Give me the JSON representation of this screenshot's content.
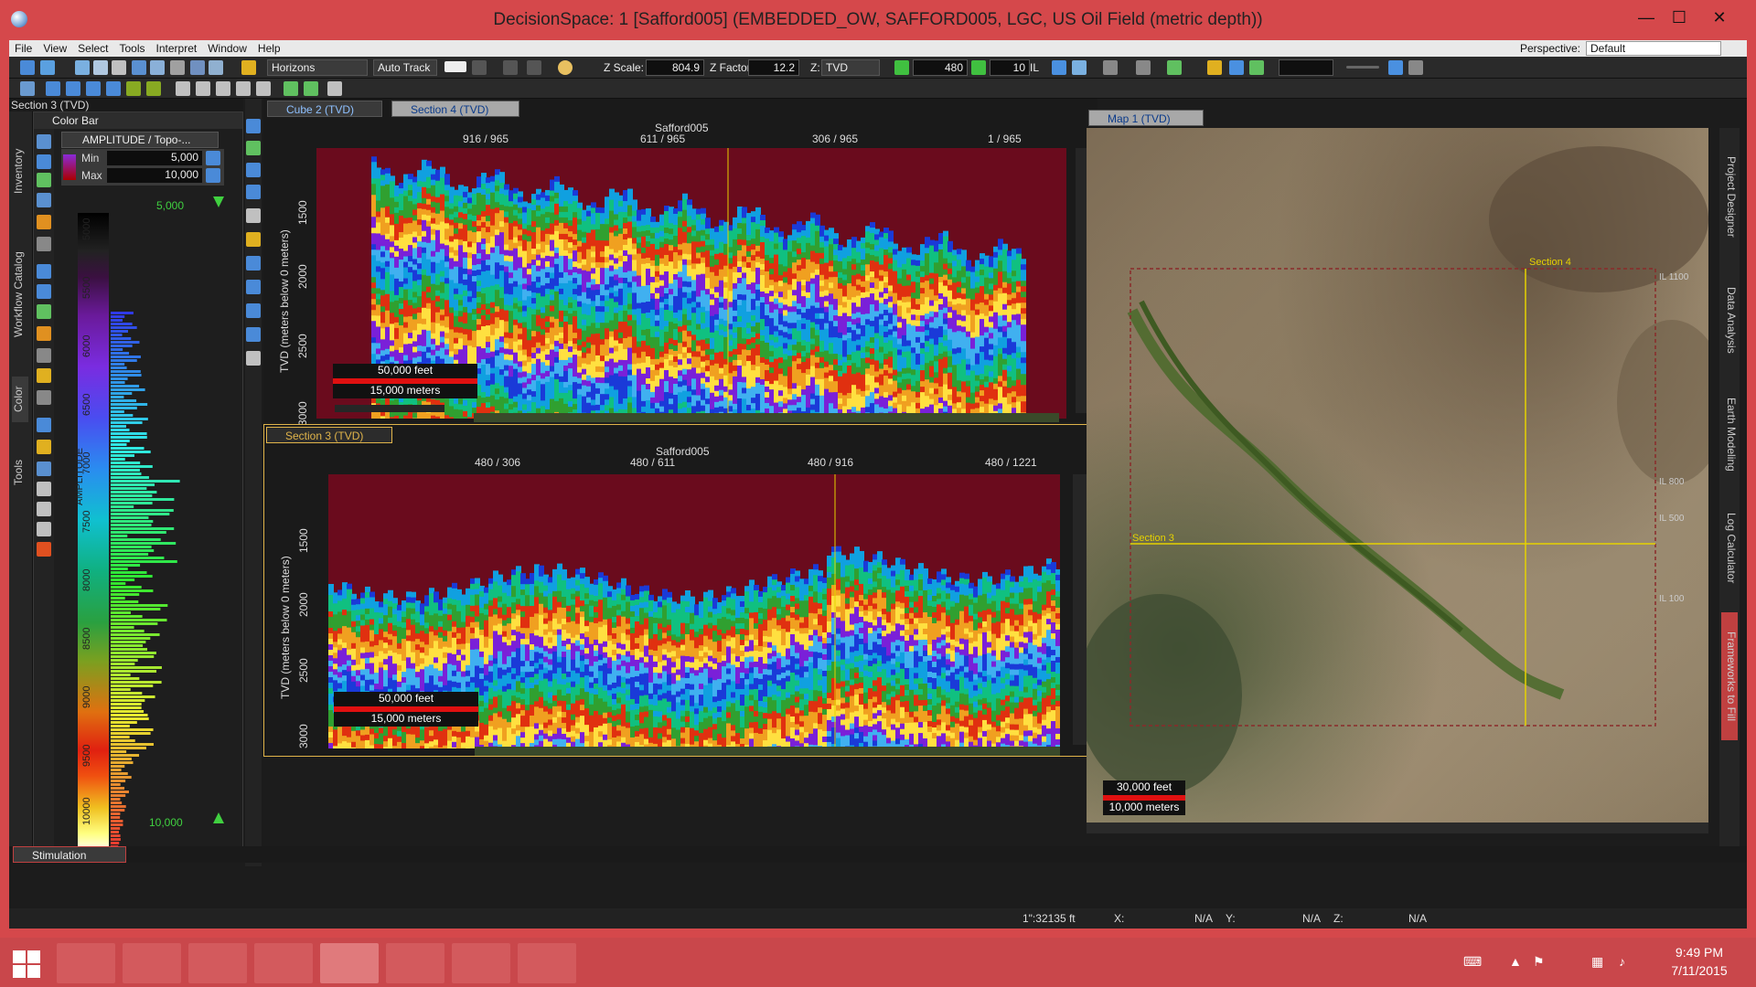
{
  "window": {
    "title": "DecisionSpace: 1 [Safford005] (EMBEDDED_OW, SAFFORD005, LGC, US Oil Field (metric depth))",
    "minimize": "—",
    "maximize": "☐",
    "close": "✕"
  },
  "menu": {
    "items": [
      "File",
      "View",
      "Select",
      "Tools",
      "Interpret",
      "Window",
      "Help"
    ],
    "perspective_label": "Perspective:",
    "perspective_value": "Default"
  },
  "toolbar": {
    "horizons": "Horizons",
    "autotrack": "Auto Track",
    "zscale_label": "Z Scale:",
    "zscale_value": "804.9",
    "zfactor_label": "Z Factor:",
    "zfactor_value": "12.2",
    "z_label": "Z:",
    "z_value": "TVD",
    "step_value": "480",
    "inc_value": "10",
    "il_label": "IL"
  },
  "left_panel": {
    "section_title": "Section 3 (TVD)",
    "vtabs": [
      "Inventory",
      "Workflow Catalog",
      "Color",
      "Tools"
    ],
    "colorbar_title": "Color Bar",
    "attribute": "AMPLITUDE / Topo-...",
    "min_label": "Min",
    "min_value": "5,000",
    "max_label": "Max",
    "max_value": "10,000",
    "top_value": "5,000",
    "bottom_value": "10,000",
    "axis_label": "AMPLITUDE",
    "ticks": [
      "5000",
      "5500",
      "6000",
      "6500",
      "7000",
      "7500",
      "8000",
      "8500",
      "9000",
      "9500",
      "10000"
    ]
  },
  "section4": {
    "tab_cube": "Cube 2 (TVD)",
    "tab_active": "Section 4 (TVD)",
    "survey": "Safford005",
    "top_ticks": [
      "916 / 965",
      "611 / 965",
      "306 / 965",
      "1 / 965"
    ],
    "ylabel": "TVD (meters below 0 meters)",
    "yticks": [
      "1500",
      "2000",
      "2500",
      "3000"
    ],
    "scale_feet": "50,000 feet",
    "scale_meters": "15,000 meters"
  },
  "section3": {
    "tab": "Section 3 (TVD)",
    "survey": "Safford005",
    "top_ticks": [
      "480 / 306",
      "480 / 611",
      "480 / 916",
      "480 / 1221"
    ],
    "ylabel": "TVD (meters below 0 meters)",
    "yticks": [
      "1500",
      "2000",
      "2500",
      "3000"
    ],
    "scale_feet": "50,000 feet",
    "scale_meters": "15,000 meters"
  },
  "map": {
    "tab": "Map 1 (TVD)",
    "label_section4": "Section 4",
    "label_section3": "Section 3",
    "il_labels": [
      "IL 1100",
      "IL 800",
      "IL 500",
      "IL 100"
    ],
    "scale_feet": "30,000 feet",
    "scale_meters": "10,000 meters"
  },
  "right_panel": {
    "vtabs": [
      "Project Designer",
      "Data Analysis",
      "Earth Modeling",
      "Log Calculator",
      "Frameworks to Fill"
    ]
  },
  "bottom": {
    "stimulation_tab": "Stimulation",
    "scale": "1\":32135 ft",
    "x_label": "X:",
    "x_value": "N/A",
    "y_label": "Y:",
    "y_value": "N/A",
    "z_label": "Z:",
    "z_value": "N/A"
  },
  "taskbar": {
    "time": "9:49 PM",
    "date": "7/11/2015"
  },
  "colors": {
    "title_bar": "#d5484b",
    "seismic_top": "#6a0b1d",
    "highlight_tab": "#e0b44a",
    "section_line": "#e6d200",
    "scale_red": "#e01010"
  }
}
